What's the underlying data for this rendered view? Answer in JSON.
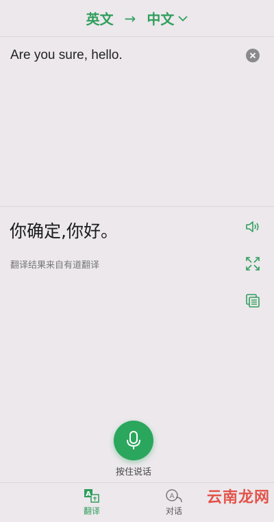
{
  "header": {
    "source_lang": "英文",
    "arrow": "→",
    "target_lang": "中文"
  },
  "input": {
    "text": "Are you sure, hello."
  },
  "result": {
    "translation": "你确定,你好。",
    "source_note": "翻译结果来自有道翻译"
  },
  "voice": {
    "label": "按住说话"
  },
  "nav": {
    "items": [
      {
        "label": "翻译",
        "icon": "translate-icon",
        "active": true
      },
      {
        "label": "对话",
        "icon": "conversation-icon",
        "active": false
      }
    ]
  },
  "watermark": "云南龙网",
  "colors": {
    "accent": "#2e9e5b",
    "background": "#ece8ec",
    "watermark": "#e2534a"
  }
}
